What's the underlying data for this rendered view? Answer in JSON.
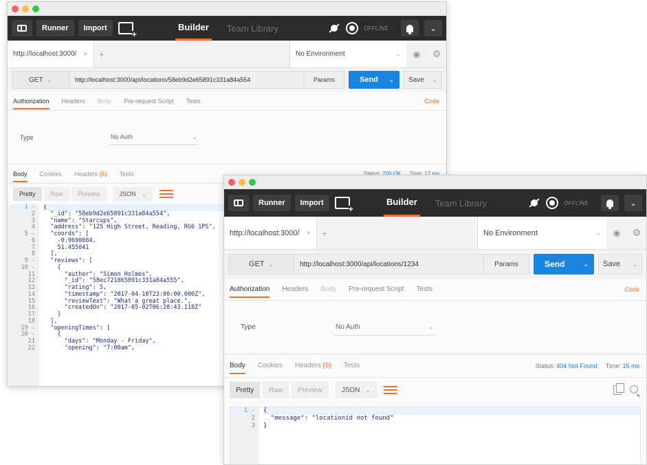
{
  "toolbar": {
    "runner": "Runner",
    "import": "Import",
    "builder": "Builder",
    "team_library": "Team Library",
    "offline": "OFFLINE"
  },
  "tab": {
    "url_short": "http://localhost:3000/",
    "close": "×",
    "add": "+"
  },
  "env": {
    "label": "No Environment"
  },
  "request_tabs": {
    "authorization": "Authorization",
    "headers": "Headers",
    "body": "Body",
    "prerequest": "Pre-request Script",
    "tests": "Tests",
    "code": "Code"
  },
  "auth": {
    "type_label": "Type",
    "type_value": "No Auth"
  },
  "response_tabs": {
    "body": "Body",
    "cookies": "Cookies",
    "headers_label": "Headers",
    "headers_count": "(6)",
    "tests": "Tests",
    "status_label": "Status:",
    "time_label": "Time:"
  },
  "body_bar": {
    "pretty": "Pretty",
    "raw": "Raw",
    "preview": "Preview",
    "format": "JSON"
  },
  "buttons": {
    "params": "Params",
    "send": "Send",
    "save": "Save"
  },
  "window1": {
    "method": "GET",
    "url": "http://localhost:3000/api/locations/58eb9d2e65891c331a84a554",
    "status": "200 OK",
    "time": "12 ms",
    "line_numbers": [
      "1 -",
      "2",
      "3",
      "4",
      "5 -",
      "6",
      "7",
      "8",
      "9 -",
      "10 -",
      "11",
      "12",
      "13",
      "14",
      "15",
      "16",
      "17",
      "18",
      "19 -",
      "20 -",
      "21",
      "22"
    ],
    "code_lines": [
      "{",
      "  \"_id\": \"58eb9d2e65891c331a84a554\",",
      "  \"name\": \"Starcups\",",
      "  \"address\": \"125 High Street, Reading, RG6 1PS\",",
      "  \"coords\": [",
      "    -0.9690884,",
      "    51.455041",
      "  ],",
      "  \"reviews\": [",
      "    {",
      "      \"author\": \"Simon Holmes\",",
      "      \"_id\": \"58ec721865891c331a84a555\",",
      "      \"rating\": 5,",
      "      \"timestamp\": \"2017-04-10T23:00:00.000Z\",",
      "      \"reviewText\": \"What a great place.\",",
      "      \"createdOn\": \"2017-05-02T06:28:43.118Z\"",
      "    }",
      "  ],",
      "  \"openingTimes\": [",
      "    {",
      "      \"days\": \"Monday - Friday\",",
      "      \"opening\": \"7:00am\","
    ]
  },
  "window2": {
    "method": "GET",
    "url": "http://localhost:3000/api/locations/1234",
    "status": "404 Not Found",
    "time": "15 ms",
    "line_numbers": [
      "1 -",
      "2",
      "3"
    ],
    "code_lines": [
      "{",
      "  \"message\": \"locationid not found\"",
      "}"
    ]
  },
  "colors": {
    "accent": "#f47023",
    "send_blue": "#1a84e0",
    "toolbar_dark": "#2c2c2c"
  }
}
